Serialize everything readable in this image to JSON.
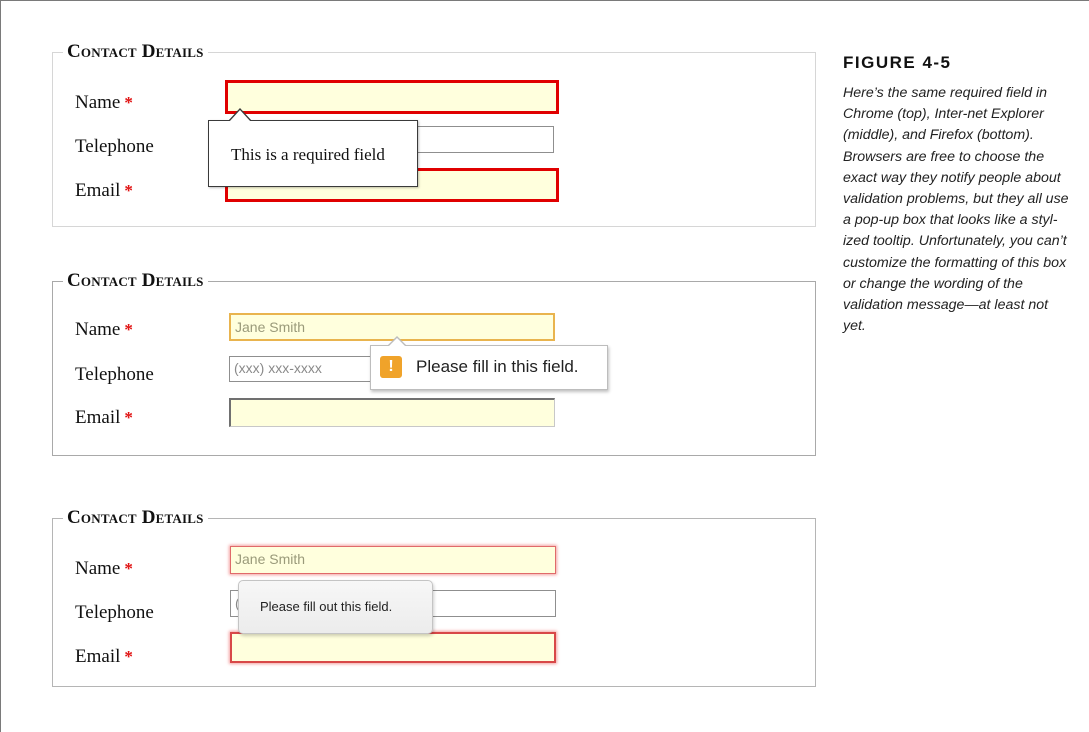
{
  "figure": {
    "title": "FIGURE 4-5",
    "caption": "Here’s the same required field in Chrome (top), Inter-net Explorer (middle), and Firefox (bottom). Browsers are free to choose the exact way they notify people about validation problems, but they all use a pop-up box that looks like a styl-ized tooltip. Unfortunately, you can’t customize the formatting of this box or change the wording of the validation message—at least not yet."
  },
  "forms": [
    {
      "browser": "Chrome",
      "legend": "Contact Details",
      "fields": [
        {
          "label": "Name",
          "required_mark": "*",
          "value": ""
        },
        {
          "label": "Telephone",
          "required_mark": "",
          "value": ""
        },
        {
          "label": "Email",
          "required_mark": "*",
          "value": ""
        }
      ],
      "tooltip": "This is a required field"
    },
    {
      "browser": "Internet Explorer",
      "legend": "Contact Details",
      "fields": [
        {
          "label": "Name",
          "required_mark": "*",
          "value": "Jane Smith"
        },
        {
          "label": "Telephone",
          "required_mark": "",
          "value": "",
          "placeholder": "(xxx) xxx-xxxx"
        },
        {
          "label": "Email",
          "required_mark": "*",
          "value": ""
        }
      ],
      "tooltip": "Please fill in this field.",
      "tooltip_icon": "!"
    },
    {
      "browser": "Firefox",
      "legend": "Contact Details",
      "fields": [
        {
          "label": "Name",
          "required_mark": "*",
          "value": "Jane Smith"
        },
        {
          "label": "Telephone",
          "required_mark": "",
          "value": "",
          "placeholder": "(xxx) xxx-xxxx"
        },
        {
          "label": "Email",
          "required_mark": "*",
          "value": ""
        }
      ],
      "tooltip": "Please fill out this field."
    }
  ],
  "colors": {
    "required_asterisk": "#e01010",
    "chrome_error_border": "#e00000",
    "ie_focus_border": "#e9b44e",
    "ie_warning_icon": "#f0a32a",
    "firefox_error_glow": "#f3a0a0",
    "field_background": "#ffffdd"
  }
}
